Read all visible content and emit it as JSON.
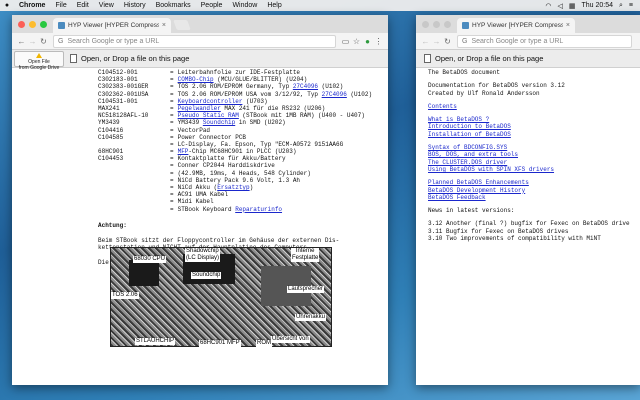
{
  "menubar": {
    "apple": "",
    "items": [
      "Chrome",
      "File",
      "Edit",
      "View",
      "History",
      "Bookmarks",
      "People",
      "Window",
      "Help"
    ],
    "status": [
      "Thu 20:54",
      "⌕",
      "≡"
    ]
  },
  "left_window": {
    "tab_title": "HYP Viewer [HYPER Compress...",
    "omnibox_placeholder": "Search Google or type a URL",
    "gdrive_button": "Open File\nfrom Google Drive",
    "open_label": "Open, or Drop a file on this page",
    "parts": [
      {
        "code": "C104512-001",
        "desc": "Leiterbahnfolie zur IDE-Festplatte"
      },
      {
        "code": "C302183-001",
        "desc": "COMBO-Chip (MCU/GLUE/BLITTER) (U204)",
        "link": "COMBO-Chip"
      },
      {
        "code": "C302383-001GER",
        "desc": "TOS 2.06 ROM/EPROM Germany, Typ 27C4096 (U102)",
        "link": "27C4096"
      },
      {
        "code": "C302362-001USA",
        "desc": "TOS 2.06 ROM/EPROM USA vom 3/12/92, Typ 27C4096 (U102)",
        "link": "27C4096"
      },
      {
        "code": "C104531-001",
        "desc": "Keyboardcontroller (U703)",
        "link": "Keyboardcontroller"
      },
      {
        "code": "MAX241",
        "desc": "Pegelwandler MAX 241 für die RS232 (U206)",
        "link": "Pegelwandler"
      },
      {
        "code": "NC518128AFL-10",
        "desc": "Pseudo Static RAM (STBook mit 1MB RAM) (U400 - U407)",
        "link": "Pseudo Static RAM"
      },
      {
        "code": "YM3439",
        "desc": "YM3439 Soundchip in SMD (U202)",
        "link": "Soundchip"
      },
      {
        "code": "C104416",
        "desc": "VectorPad"
      },
      {
        "code": "C104585",
        "desc": "Power Connector PCB"
      },
      {
        "code": "",
        "desc": "LC-Display, Fa. Epson, Typ \"ECM-A0572 9151AA6G"
      },
      {
        "code": "68HC901",
        "desc": "MFP-Chip MC68HC901 in PLCC (U203)",
        "link": "MFP"
      },
      {
        "code": "C104453",
        "desc": "Kontaktplatte für Akku/Battery"
      },
      {
        "code": "",
        "desc": "Conner CP2044 Harddiskdrive"
      },
      {
        "code": "",
        "desc": "(42.9MB, 19ms, 4 Heads, 548 Cylinder)"
      },
      {
        "code": "",
        "desc": "NiCd Battery Pack 9.6 Volt, 1.3 Ah"
      },
      {
        "code": "",
        "desc": "NiCd Akku (Ersatztyp)",
        "link": "Ersatztyp"
      },
      {
        "code": "",
        "desc": "AC91 UMA Kabel"
      },
      {
        "code": "",
        "desc": "Midi Kabel"
      },
      {
        "code": "",
        "desc": "STBook Keyboard    Reparaturinfo",
        "link": "Reparaturinfo"
      }
    ],
    "achtung": "Achtung:",
    "paragraph": "Beim STBook sitzt der Floppycontroller im Gehäuse der externen Dis-\nkettenstation und NICHT auf der Hauptplatine des Computers.",
    "caption": "Die Oberseite der Hauptplatine des STBook",
    "photo_labels": [
      "68030 CPU",
      "Shadowchip\n(LC Display)",
      "Soundchip",
      "Interne\nFestplatte",
      "TOS 2.06",
      "Lautsprecher",
      "Uhrenakku",
      "STLAUHCHIP",
      "68HC901 MFP",
      "ROM",
      "Übersicht von"
    ]
  },
  "right_window": {
    "tab_title": "HYP Viewer [HYPER Compress...",
    "omnibox_placeholder": "Search Google or type a URL",
    "open_label": "Open, or Drop a file on this page",
    "lines": [
      {
        "text": "The BetaDOS document"
      },
      {
        "gap": true
      },
      {
        "text": "Documentation for BetaDOS version 3.12"
      },
      {
        "text": "Created by Ulf Ronald Andersson"
      },
      {
        "gap": true
      },
      {
        "text": "Contents",
        "link": true
      },
      {
        "gap": true
      },
      {
        "text": "What is BetaDOS ?",
        "link": true
      },
      {
        "text": "Introduction to BetaDOS",
        "link": true
      },
      {
        "text": "Installation of BetaDOS",
        "link": true
      },
      {
        "gap": true
      },
      {
        "text": "Syntax of BDCONFIG.SYS",
        "link": true
      },
      {
        "text": "BOS, DOS, and extra tools",
        "link": true
      },
      {
        "text": "The CLUSTER.DOS driver",
        "link": true
      },
      {
        "text": "Using BetaDOS with SPIN XFS drivers",
        "link": true
      },
      {
        "gap": true
      },
      {
        "text": "Planned BetaDOS Enhancements",
        "link": true
      },
      {
        "text": "BetaDOS Development History",
        "link": true
      },
      {
        "text": "BetaDOS Feedback",
        "link": true
      },
      {
        "gap": true
      },
      {
        "text": "News in latest versions:"
      },
      {
        "gap": true
      },
      {
        "text": "3.12 Another (final ?) bugfix for Fexec on BetaDOS drive"
      },
      {
        "text": "3.11 Bugfix for Fexec on BetaDOS drives"
      },
      {
        "text": "3.10 Two improvements of compatibility with MiNT"
      }
    ]
  }
}
